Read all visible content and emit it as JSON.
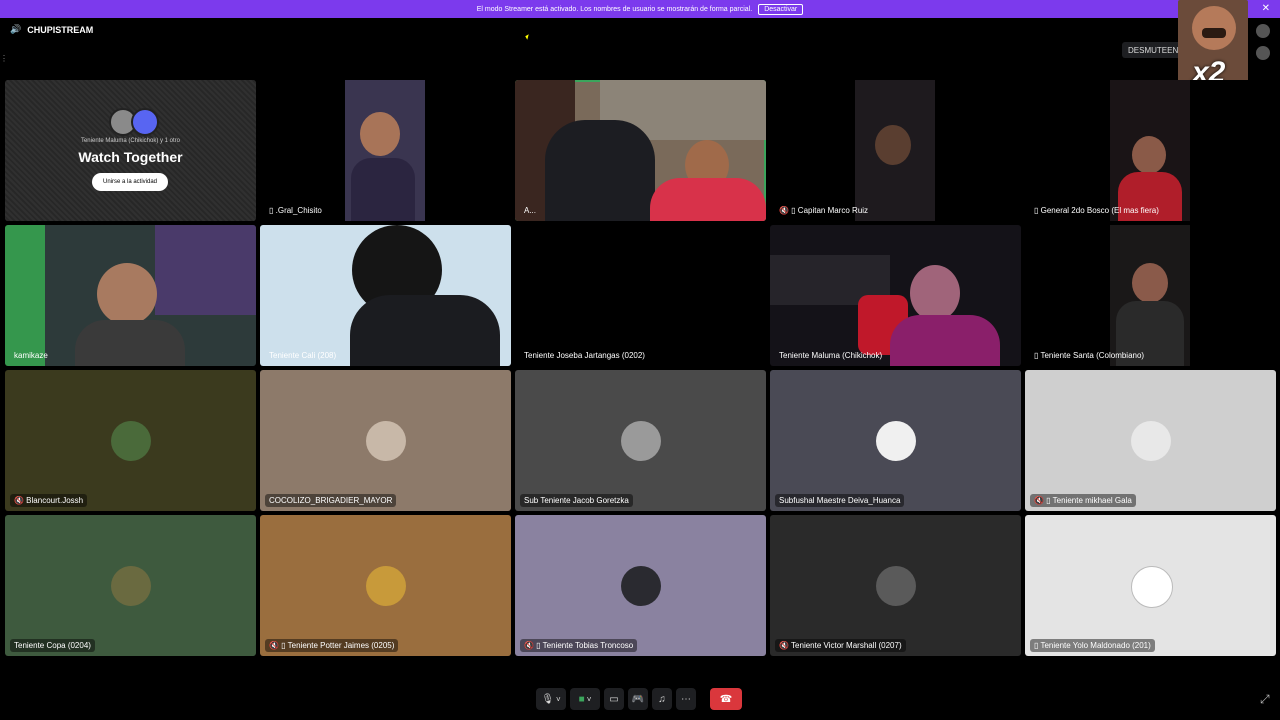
{
  "banner": {
    "text": "El modo Streamer está activado. Los nombres de usuario se mostrarán de forma parcial.",
    "button": "Desactivar",
    "close": "✕"
  },
  "header": {
    "channel_icon": "🔊",
    "channel": "CHUPISTREAM",
    "unmute": "DESMUTEENM"
  },
  "overlay": {
    "label": "x2"
  },
  "watch_together": {
    "subtitle": "Teniente Maluma (Chikichok) y 1 otro",
    "title": "Watch Together",
    "join": "Unirse a la actividad"
  },
  "tiles": {
    "gral_chisito": "▯ .Gral_Chisito",
    "a": "A...",
    "capitan": "🔇 ▯ Capitan Marco Ruiz",
    "general": "▯ General 2do Bosco (El mas fiera)",
    "kamikaze": "kamikaze",
    "cali": "Teniente Cali (208)",
    "joseba": "Teniente Joseba Jartangas (0202)",
    "maluma": "Teniente Maluma (Chikichok)",
    "santa": "▯ Teniente Santa (Colombiano)",
    "blancourt": "🔇 Blancourt.Jossh",
    "cocolizo": "COCOLIZO_BRIGADIER_MAYOR",
    "goretzka": "Sub Teniente Jacob Goretzka",
    "deiva": "Subfushal Maestre Deiva_Huanca",
    "mikhael": "🔇 ▯ Teniente mikhael Gala",
    "copa": "Teniente Copa (0204)",
    "potter": "🔇 ▯ Teniente Potter Jaimes (0205)",
    "tobias": "🔇 ▯ Teniente Tobias Troncoso",
    "victor": "🔇 Teniente Victor Marshall (0207)",
    "yolo": "▯ Teniente Yolo Maldonado (201)"
  },
  "controls": {
    "mic": "🎙",
    "mic_caret": "˅",
    "camera": "■",
    "camera_caret": "˅",
    "screen": "▭",
    "activity": "🎮",
    "soundboard": "♫",
    "more": "⋯",
    "hangup": "☎"
  },
  "fullscreen": "⤢",
  "colors": {
    "banner": "#7c3aed",
    "speaking": "#3ba55c",
    "hangup": "#da373c"
  }
}
